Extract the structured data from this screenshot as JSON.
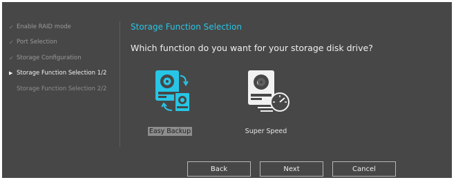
{
  "sidebar": {
    "steps": [
      {
        "label": "Enable RAID mode",
        "mark": "✓"
      },
      {
        "label": "Port Selection",
        "mark": "✓"
      },
      {
        "label": "Storage Configuration",
        "mark": "✓"
      },
      {
        "label": "Storage Function Selection 1/2",
        "mark": "▶"
      },
      {
        "label": "Storage Function Selection 2/2",
        "mark": ""
      }
    ]
  },
  "main": {
    "title": "Storage Function Selection",
    "question": "Which function do you want for your storage disk drive?",
    "options": [
      {
        "label": "Easy Backup",
        "icon": "backup-drives-icon",
        "selected": true
      },
      {
        "label": "Super Speed",
        "icon": "speed-drive-icon",
        "selected": false
      }
    ]
  },
  "buttons": {
    "back": "Back",
    "next": "Next",
    "cancel": "Cancel"
  },
  "colors": {
    "background": "#474747",
    "accent": "#27c6e6",
    "selection": "#8d8d8d"
  }
}
